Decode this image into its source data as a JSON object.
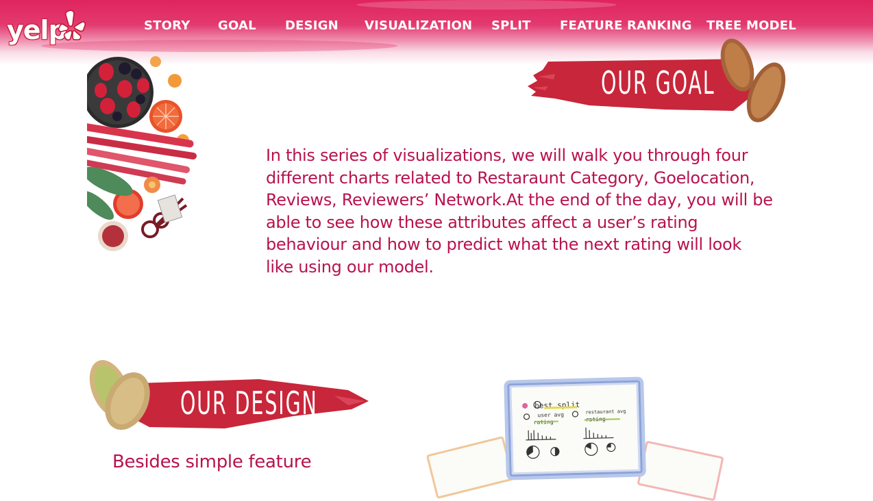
{
  "header": {
    "logo_text": "yelp",
    "nav": [
      "STORY",
      "GOAL",
      "DESIGN",
      "VISUALIZATION",
      "SPLIT",
      "FEATURE RANKING",
      "TREE MODEL"
    ]
  },
  "goal": {
    "title": "OUR GOAL",
    "text": "In this series of visualizations, we will walk you through four different charts related to Restaraunt Category, Goelocation, Reviews, Reviewers’ Network.At the end of the day, you will be able to see how these attributes affect a user’s rating behaviour and how to predict what the next rating will look like using our model."
  },
  "design": {
    "title": "OUR DESIGN",
    "text": "Besides simple feature",
    "sketch_card": {
      "heading": "best split",
      "left_label_line1": "user avg",
      "left_label_line2": "rating",
      "right_label_line1": "restaurant avg",
      "right_label_line2": "rating"
    }
  },
  "colors": {
    "brand": "#e0245e",
    "banner_red": "#c8263a",
    "text_magenta": "#b8124e"
  }
}
